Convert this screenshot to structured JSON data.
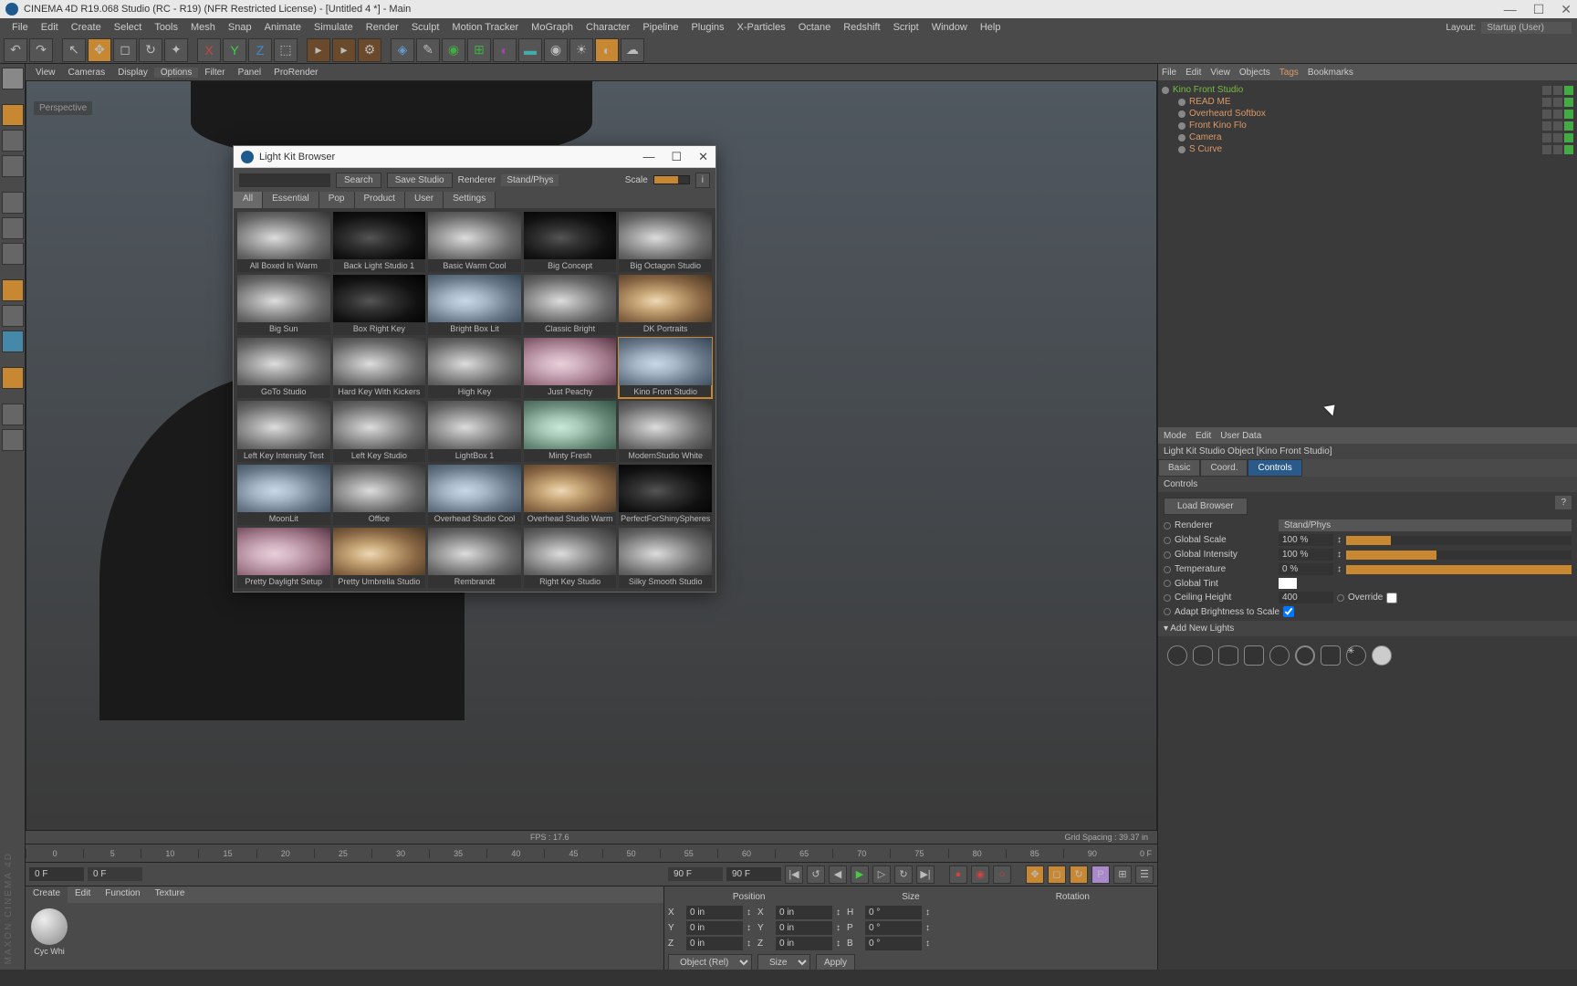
{
  "titlebar": {
    "text": "CINEMA 4D R19.068 Studio (RC - R19) (NFR Restricted License) - [Untitled 4 *] - Main"
  },
  "menubar": {
    "items": [
      "File",
      "Edit",
      "Create",
      "Select",
      "Tools",
      "Mesh",
      "Snap",
      "Animate",
      "Simulate",
      "Render",
      "Sculpt",
      "Motion Tracker",
      "MoGraph",
      "Character",
      "Pipeline",
      "Plugins",
      "X-Particles",
      "Octane",
      "Redshift",
      "Script",
      "Window",
      "Help"
    ],
    "layout_label": "Layout:",
    "layout_value": "Startup (User)"
  },
  "viewport": {
    "menu": [
      "View",
      "Cameras",
      "Display",
      "Options",
      "Filter",
      "Panel",
      "ProRender"
    ],
    "perspective": "Perspective",
    "fps": "FPS : 17.6",
    "grid": "Grid Spacing : 39.37 in"
  },
  "timeline": {
    "ticks": [
      "0",
      "5",
      "10",
      "15",
      "20",
      "25",
      "30",
      "35",
      "40",
      "45",
      "50",
      "55",
      "60",
      "65",
      "70",
      "75",
      "80",
      "85",
      "90"
    ],
    "end_label": "0 F",
    "start": "0 F",
    "range_start": "0 F",
    "range_end": "90 F",
    "end": "90 F"
  },
  "materials": {
    "menu": [
      "Create",
      "Edit",
      "Function",
      "Texture"
    ],
    "swatch_label": "Cyc Whi"
  },
  "coords": {
    "headers": [
      "Position",
      "Size",
      "Rotation"
    ],
    "rows": [
      {
        "axis": "X",
        "pos": "0 in",
        "size": "0 in",
        "rot_k": "H",
        "rot": "0 °"
      },
      {
        "axis": "Y",
        "pos": "0 in",
        "size": "0 in",
        "rot_k": "P",
        "rot": "0 °"
      },
      {
        "axis": "Z",
        "pos": "0 in",
        "size": "0 in",
        "rot_k": "B",
        "rot": "0 °"
      }
    ],
    "mode": "Object (Rel)",
    "size_mode": "Size",
    "apply": "Apply"
  },
  "objects": {
    "tabs": [
      "File",
      "Edit",
      "View",
      "Objects",
      "Tags",
      "Bookmarks"
    ],
    "tree": [
      {
        "name": "Kino Front Studio",
        "cls": "green",
        "indent": 0
      },
      {
        "name": "READ ME",
        "cls": "orange",
        "indent": 1
      },
      {
        "name": "Overheard Softbox",
        "cls": "orange",
        "indent": 1
      },
      {
        "name": "Front Kino Flo",
        "cls": "orange",
        "indent": 1
      },
      {
        "name": "Camera",
        "cls": "orange",
        "indent": 1
      },
      {
        "name": "S Curve",
        "cls": "orange",
        "indent": 1
      }
    ]
  },
  "attributes": {
    "menu": [
      "Mode",
      "Edit",
      "User Data"
    ],
    "title": "Light Kit Studio Object [Kino Front Studio]",
    "tabs": [
      "Basic",
      "Coord.",
      "Controls"
    ],
    "section": "Controls",
    "load_browser": "Load Browser",
    "renderer_label": "Renderer",
    "renderer_value": "Stand/Phys",
    "params": [
      {
        "label": "Global Scale",
        "val": "100 %",
        "fill": 20
      },
      {
        "label": "Global Intensity",
        "val": "100 %",
        "fill": 40
      },
      {
        "label": "Temperature",
        "val": "0 %",
        "fill": 100
      }
    ],
    "tint_label": "Global Tint",
    "ceiling_label": "Ceiling Height",
    "ceiling_val": "400",
    "override_label": "Override",
    "adapt_label": "Adapt Brightness to Scale",
    "add_lights": "Add New Lights"
  },
  "modal": {
    "title": "Light Kit Browser",
    "search_btn": "Search",
    "save_btn": "Save Studio",
    "renderer_label": "Renderer",
    "renderer_value": "Stand/Phys",
    "scale_label": "Scale",
    "tabs": [
      "All",
      "Essential",
      "Pop",
      "Product",
      "User",
      "Settings"
    ],
    "presets": [
      {
        "label": "All Boxed In Warm",
        "cls": ""
      },
      {
        "label": "Back Light Studio 1",
        "cls": "dark"
      },
      {
        "label": "Basic Warm Cool",
        "cls": ""
      },
      {
        "label": "Big Concept",
        "cls": "dark"
      },
      {
        "label": "Big Octagon Studio",
        "cls": ""
      },
      {
        "label": "Big Sun",
        "cls": ""
      },
      {
        "label": "Box Right Key",
        "cls": "dark"
      },
      {
        "label": "Bright Box Lit",
        "cls": "cool"
      },
      {
        "label": "Classic Bright",
        "cls": ""
      },
      {
        "label": "DK Portraits",
        "cls": "warm"
      },
      {
        "label": "GoTo Studio",
        "cls": ""
      },
      {
        "label": "Hard Key With Kickers",
        "cls": ""
      },
      {
        "label": "High Key",
        "cls": ""
      },
      {
        "label": "Just Peachy",
        "cls": "pink"
      },
      {
        "label": "Kino Front Studio",
        "cls": "cool",
        "selected": true
      },
      {
        "label": "Left Key Intensity Test",
        "cls": ""
      },
      {
        "label": "Left Key Studio",
        "cls": ""
      },
      {
        "label": "LightBox 1",
        "cls": ""
      },
      {
        "label": "Minty Fresh",
        "cls": "green"
      },
      {
        "label": "ModernStudio White",
        "cls": ""
      },
      {
        "label": "MoonLit",
        "cls": "cool"
      },
      {
        "label": "Office",
        "cls": ""
      },
      {
        "label": "Overhead Studio Cool",
        "cls": "cool"
      },
      {
        "label": "Overhead Studio Warm",
        "cls": "warm"
      },
      {
        "label": "PerfectForShinySpheres",
        "cls": "dark"
      },
      {
        "label": "Pretty Daylight Setup",
        "cls": "pink"
      },
      {
        "label": "Pretty Umbrella Studio",
        "cls": "warm"
      },
      {
        "label": "Rembrandt",
        "cls": ""
      },
      {
        "label": "Right Key Studio",
        "cls": ""
      },
      {
        "label": "Silky Smooth Studio",
        "cls": ""
      }
    ]
  },
  "brand": "MAXON CINEMA 4D"
}
